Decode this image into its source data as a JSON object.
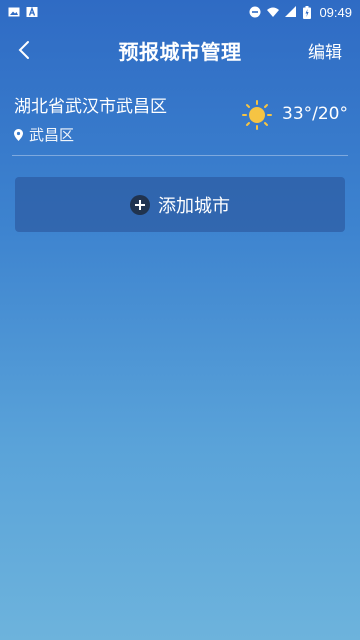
{
  "status_bar": {
    "time": "09:49",
    "icons": [
      "image-icon",
      "font-icon",
      "dnd-icon",
      "wifi-icon",
      "signal-icon",
      "battery-charging-icon"
    ]
  },
  "toolbar": {
    "title": "预报城市管理",
    "edit_label": "编辑",
    "back_icon": "chevron-left-icon"
  },
  "cities": [
    {
      "name": "湖北省武汉市武昌区",
      "location": "武昌区",
      "location_icon": "location-pin-icon",
      "weather_icon": "sun-icon",
      "temperature": "33°/20°"
    }
  ],
  "add_city": {
    "label": "添加城市",
    "icon": "plus-circle-icon"
  },
  "colors": {
    "gradient_top": "#2f6bc4",
    "gradient_bottom": "#6db3dc",
    "add_button_bg": "#2e5a9c",
    "sun_color": "#f6c443"
  }
}
